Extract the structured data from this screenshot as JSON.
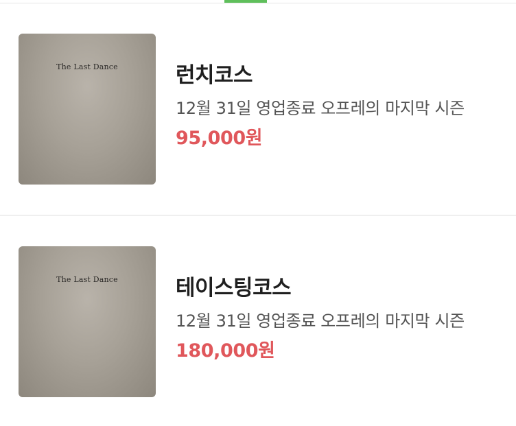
{
  "tabs": {
    "active_indicator_color": "#5fbf5b"
  },
  "items": [
    {
      "image_text": "The Last Dance",
      "title": "런치코스",
      "description": "12월 31일 영업종료 오프레의 마지막 시즌",
      "price": "95,000원"
    },
    {
      "image_text": "The Last Dance",
      "title": "테이스팅코스",
      "description": "12월 31일 영업종료 오프레의 마지막 시즌",
      "price": "180,000원"
    }
  ],
  "colors": {
    "price": "#e0575b",
    "title": "#1f1f1f",
    "description": "#555555"
  }
}
